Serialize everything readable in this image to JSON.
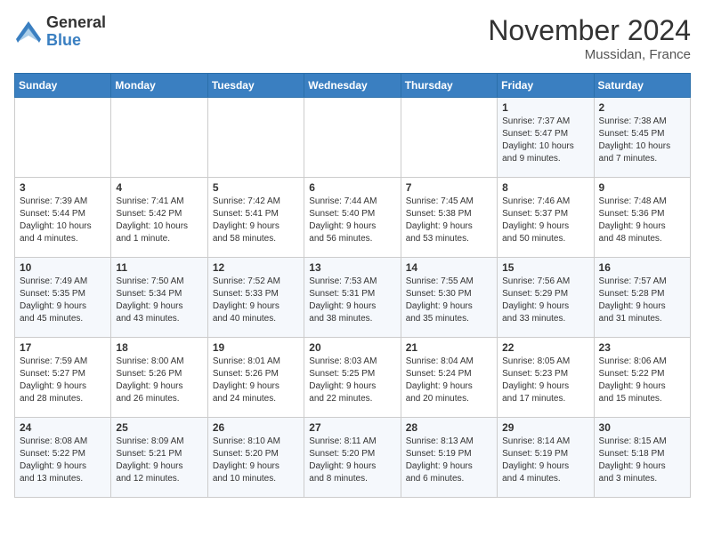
{
  "logo": {
    "general": "General",
    "blue": "Blue"
  },
  "title": "November 2024",
  "location": "Mussidan, France",
  "headers": [
    "Sunday",
    "Monday",
    "Tuesday",
    "Wednesday",
    "Thursday",
    "Friday",
    "Saturday"
  ],
  "weeks": [
    [
      {
        "day": "",
        "info": ""
      },
      {
        "day": "",
        "info": ""
      },
      {
        "day": "",
        "info": ""
      },
      {
        "day": "",
        "info": ""
      },
      {
        "day": "",
        "info": ""
      },
      {
        "day": "1",
        "info": "Sunrise: 7:37 AM\nSunset: 5:47 PM\nDaylight: 10 hours\nand 9 minutes."
      },
      {
        "day": "2",
        "info": "Sunrise: 7:38 AM\nSunset: 5:45 PM\nDaylight: 10 hours\nand 7 minutes."
      }
    ],
    [
      {
        "day": "3",
        "info": "Sunrise: 7:39 AM\nSunset: 5:44 PM\nDaylight: 10 hours\nand 4 minutes."
      },
      {
        "day": "4",
        "info": "Sunrise: 7:41 AM\nSunset: 5:42 PM\nDaylight: 10 hours\nand 1 minute."
      },
      {
        "day": "5",
        "info": "Sunrise: 7:42 AM\nSunset: 5:41 PM\nDaylight: 9 hours\nand 58 minutes."
      },
      {
        "day": "6",
        "info": "Sunrise: 7:44 AM\nSunset: 5:40 PM\nDaylight: 9 hours\nand 56 minutes."
      },
      {
        "day": "7",
        "info": "Sunrise: 7:45 AM\nSunset: 5:38 PM\nDaylight: 9 hours\nand 53 minutes."
      },
      {
        "day": "8",
        "info": "Sunrise: 7:46 AM\nSunset: 5:37 PM\nDaylight: 9 hours\nand 50 minutes."
      },
      {
        "day": "9",
        "info": "Sunrise: 7:48 AM\nSunset: 5:36 PM\nDaylight: 9 hours\nand 48 minutes."
      }
    ],
    [
      {
        "day": "10",
        "info": "Sunrise: 7:49 AM\nSunset: 5:35 PM\nDaylight: 9 hours\nand 45 minutes."
      },
      {
        "day": "11",
        "info": "Sunrise: 7:50 AM\nSunset: 5:34 PM\nDaylight: 9 hours\nand 43 minutes."
      },
      {
        "day": "12",
        "info": "Sunrise: 7:52 AM\nSunset: 5:33 PM\nDaylight: 9 hours\nand 40 minutes."
      },
      {
        "day": "13",
        "info": "Sunrise: 7:53 AM\nSunset: 5:31 PM\nDaylight: 9 hours\nand 38 minutes."
      },
      {
        "day": "14",
        "info": "Sunrise: 7:55 AM\nSunset: 5:30 PM\nDaylight: 9 hours\nand 35 minutes."
      },
      {
        "day": "15",
        "info": "Sunrise: 7:56 AM\nSunset: 5:29 PM\nDaylight: 9 hours\nand 33 minutes."
      },
      {
        "day": "16",
        "info": "Sunrise: 7:57 AM\nSunset: 5:28 PM\nDaylight: 9 hours\nand 31 minutes."
      }
    ],
    [
      {
        "day": "17",
        "info": "Sunrise: 7:59 AM\nSunset: 5:27 PM\nDaylight: 9 hours\nand 28 minutes."
      },
      {
        "day": "18",
        "info": "Sunrise: 8:00 AM\nSunset: 5:26 PM\nDaylight: 9 hours\nand 26 minutes."
      },
      {
        "day": "19",
        "info": "Sunrise: 8:01 AM\nSunset: 5:26 PM\nDaylight: 9 hours\nand 24 minutes."
      },
      {
        "day": "20",
        "info": "Sunrise: 8:03 AM\nSunset: 5:25 PM\nDaylight: 9 hours\nand 22 minutes."
      },
      {
        "day": "21",
        "info": "Sunrise: 8:04 AM\nSunset: 5:24 PM\nDaylight: 9 hours\nand 20 minutes."
      },
      {
        "day": "22",
        "info": "Sunrise: 8:05 AM\nSunset: 5:23 PM\nDaylight: 9 hours\nand 17 minutes."
      },
      {
        "day": "23",
        "info": "Sunrise: 8:06 AM\nSunset: 5:22 PM\nDaylight: 9 hours\nand 15 minutes."
      }
    ],
    [
      {
        "day": "24",
        "info": "Sunrise: 8:08 AM\nSunset: 5:22 PM\nDaylight: 9 hours\nand 13 minutes."
      },
      {
        "day": "25",
        "info": "Sunrise: 8:09 AM\nSunset: 5:21 PM\nDaylight: 9 hours\nand 12 minutes."
      },
      {
        "day": "26",
        "info": "Sunrise: 8:10 AM\nSunset: 5:20 PM\nDaylight: 9 hours\nand 10 minutes."
      },
      {
        "day": "27",
        "info": "Sunrise: 8:11 AM\nSunset: 5:20 PM\nDaylight: 9 hours\nand 8 minutes."
      },
      {
        "day": "28",
        "info": "Sunrise: 8:13 AM\nSunset: 5:19 PM\nDaylight: 9 hours\nand 6 minutes."
      },
      {
        "day": "29",
        "info": "Sunrise: 8:14 AM\nSunset: 5:19 PM\nDaylight: 9 hours\nand 4 minutes."
      },
      {
        "day": "30",
        "info": "Sunrise: 8:15 AM\nSunset: 5:18 PM\nDaylight: 9 hours\nand 3 minutes."
      }
    ]
  ]
}
